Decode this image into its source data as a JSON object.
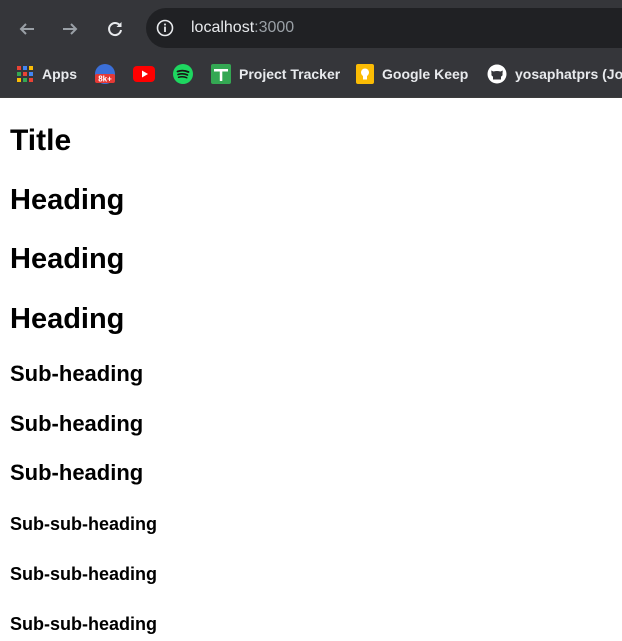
{
  "browser": {
    "url_host": "localhost",
    "url_port": ":3000",
    "nav": {
      "back_icon": "arrow-back-icon",
      "forward_icon": "arrow-forward-icon",
      "reload_icon": "reload-icon"
    },
    "bookmarks": [
      {
        "label": "Apps",
        "icon": "apps-grid-icon"
      },
      {
        "label": "",
        "icon": "8k-badge-icon",
        "badge_text": "8k+"
      },
      {
        "label": "",
        "icon": "youtube-icon"
      },
      {
        "label": "",
        "icon": "spotify-icon"
      },
      {
        "label": "Project Tracker",
        "icon": "project-tracker-icon"
      },
      {
        "label": "Google Keep",
        "icon": "google-keep-icon"
      },
      {
        "label": "yosaphatprs (Jos",
        "icon": "github-icon"
      }
    ],
    "colors": {
      "chrome_bg": "#35363a",
      "omnibox_bg": "#202124",
      "text_light": "#e8eaed",
      "text_dim": "#9aa0a6"
    }
  },
  "page": {
    "title": "Title",
    "headings": [
      "Heading",
      "Heading",
      "Heading"
    ],
    "subheadings": [
      "Sub-heading",
      "Sub-heading",
      "Sub-heading"
    ],
    "subsubheadings": [
      "Sub-sub-heading",
      "Sub-sub-heading",
      "Sub-sub-heading"
    ]
  }
}
